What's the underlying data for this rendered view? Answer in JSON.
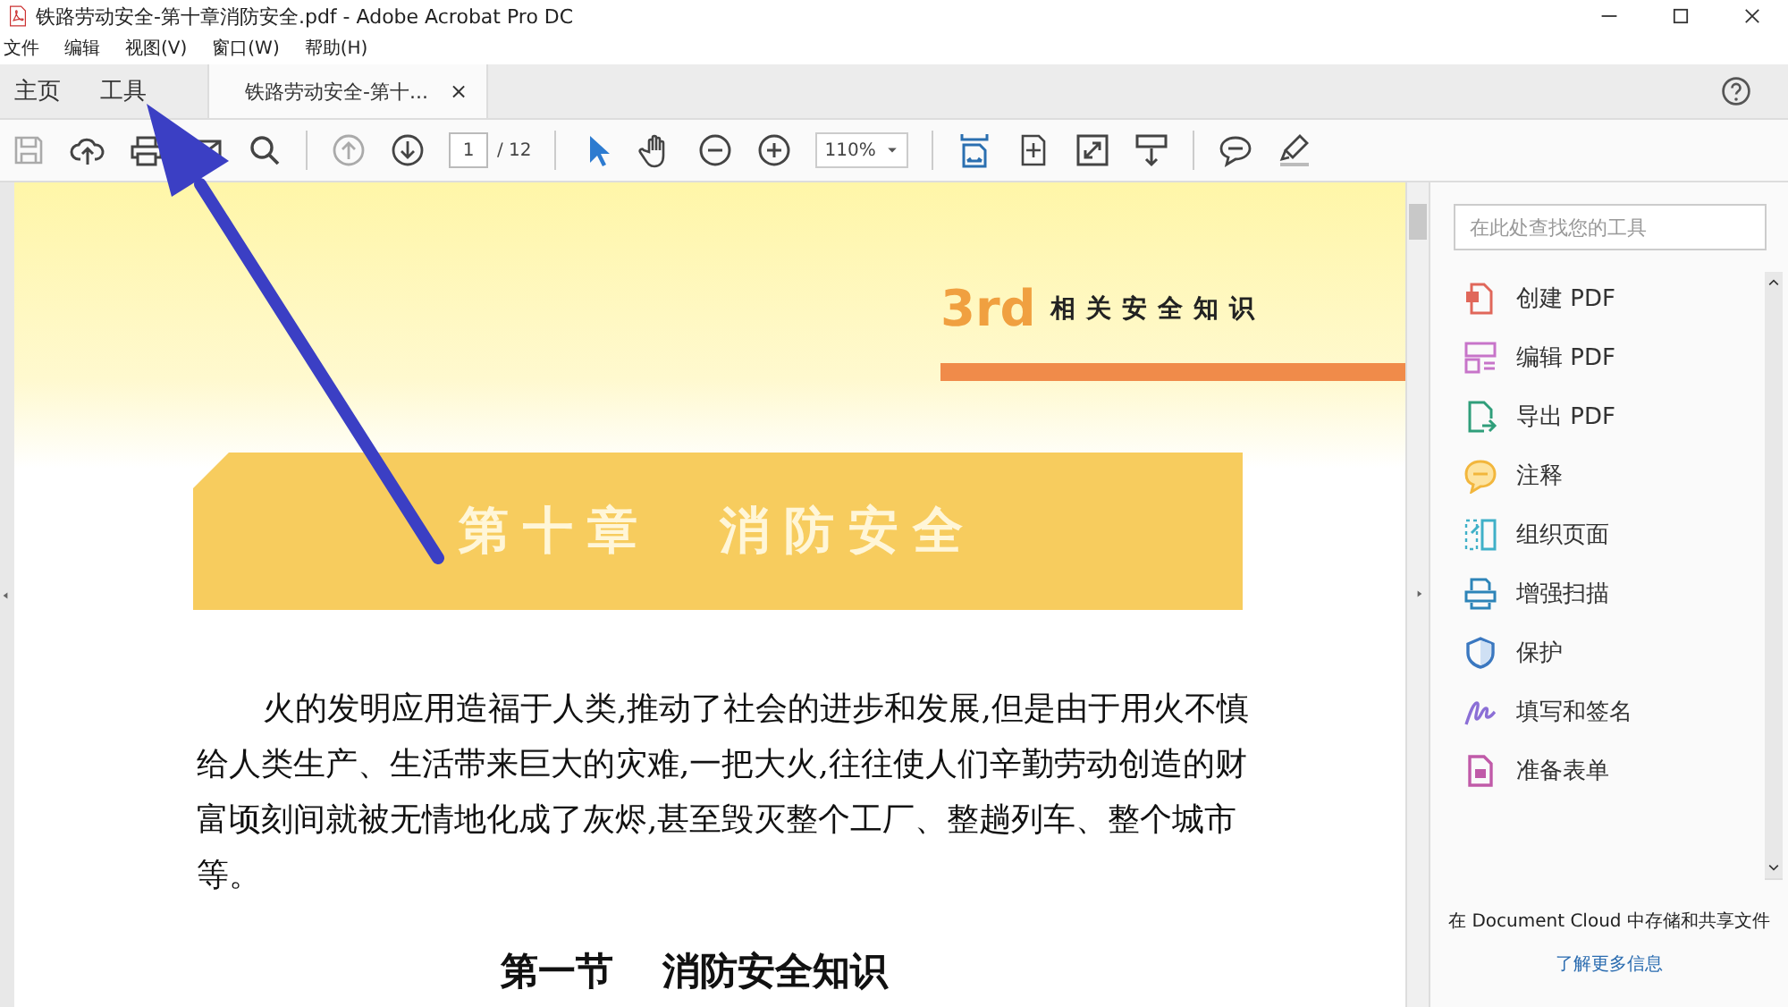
{
  "window": {
    "title": "铁路劳动安全-第十章消防安全.pdf - Adobe Acrobat Pro DC"
  },
  "menu_bar": [
    "文件",
    "编辑",
    "视图(V)",
    "窗口(W)",
    "帮助(H)"
  ],
  "tabs": [
    {
      "label": "主页",
      "selected": false
    },
    {
      "label": "工具",
      "selected": false
    },
    {
      "label": "铁路劳动安全-第十...",
      "selected": true,
      "close": "×"
    }
  ],
  "toolbar": {
    "page": "1",
    "page_count": "/ 12",
    "zoom": "110%"
  },
  "document": {
    "header_mark": "3rd",
    "header_title": "相关安全知识",
    "chapter_title": "第十章 消防安全",
    "paragraph": "火的发明应用造福于人类,推动了社会的进步和发展,但是由于用火不慎给人类生产、生活带来巨大的灾难,一把大火,往往使人们辛勤劳动创造的财富顷刻间就被无情地化成了灰烬,甚至毁灭整个工厂、整趟列车、整个城市等。",
    "section_title": "第一节 消防安全知识"
  },
  "tools_pane": {
    "search": {
      "placeholder": "在此处查找您的工具"
    },
    "tools": [
      {
        "label": "创建 PDF",
        "color": "#e0675a"
      },
      {
        "label": "编辑 PDF",
        "color": "#c774c9"
      },
      {
        "label": "导出 PDF",
        "color": "#2f9e7a"
      },
      {
        "label": "注释",
        "color": "#f2b63c"
      },
      {
        "label": "组织页面",
        "color": "#3fb0c8"
      },
      {
        "label": "增强扫描",
        "color": "#2d84b8"
      },
      {
        "label": "保护",
        "color": "#3b78c0"
      },
      {
        "label": "填写和签名",
        "color": "#8b6fd6"
      },
      {
        "label": "准备表单",
        "color": "#c05aa8"
      }
    ],
    "cloud_note": "在 Document Cloud 中存储和共享文件",
    "learn_more": "了解更多信息"
  }
}
